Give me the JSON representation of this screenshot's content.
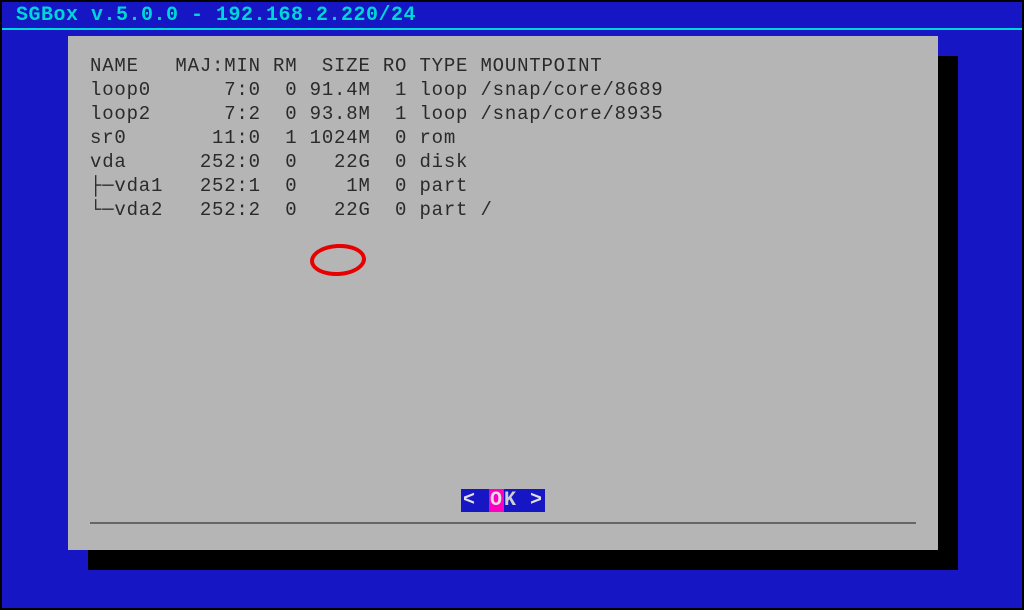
{
  "title": "SGBox v.5.0.0 - 192.168.2.220/24",
  "columns": [
    "NAME",
    "MAJ:MIN",
    "RM",
    "SIZE",
    "RO",
    "TYPE",
    "MOUNTPOINT"
  ],
  "rows": [
    {
      "name": "loop0",
      "majmin": "7:0",
      "rm": "0",
      "size": "91.4M",
      "ro": "1",
      "type": "loop",
      "mount": "/snap/core/8689",
      "prefix": ""
    },
    {
      "name": "loop2",
      "majmin": "7:2",
      "rm": "0",
      "size": "93.8M",
      "ro": "1",
      "type": "loop",
      "mount": "/snap/core/8935",
      "prefix": ""
    },
    {
      "name": "sr0",
      "majmin": "11:0",
      "rm": "1",
      "size": "1024M",
      "ro": "0",
      "type": "rom",
      "mount": "",
      "prefix": ""
    },
    {
      "name": "vda",
      "majmin": "252:0",
      "rm": "0",
      "size": "22G",
      "ro": "0",
      "type": "disk",
      "mount": "",
      "prefix": ""
    },
    {
      "name": "vda1",
      "majmin": "252:1",
      "rm": "0",
      "size": "1M",
      "ro": "0",
      "type": "part",
      "mount": "",
      "prefix": "├─"
    },
    {
      "name": "vda2",
      "majmin": "252:2",
      "rm": "0",
      "size": "22G",
      "ro": "0",
      "type": "part",
      "mount": "/",
      "prefix": "└─"
    }
  ],
  "button": {
    "left": "<",
    "label": "OK",
    "right": ">"
  },
  "highlight": {
    "row_index": 5,
    "field": "size"
  }
}
